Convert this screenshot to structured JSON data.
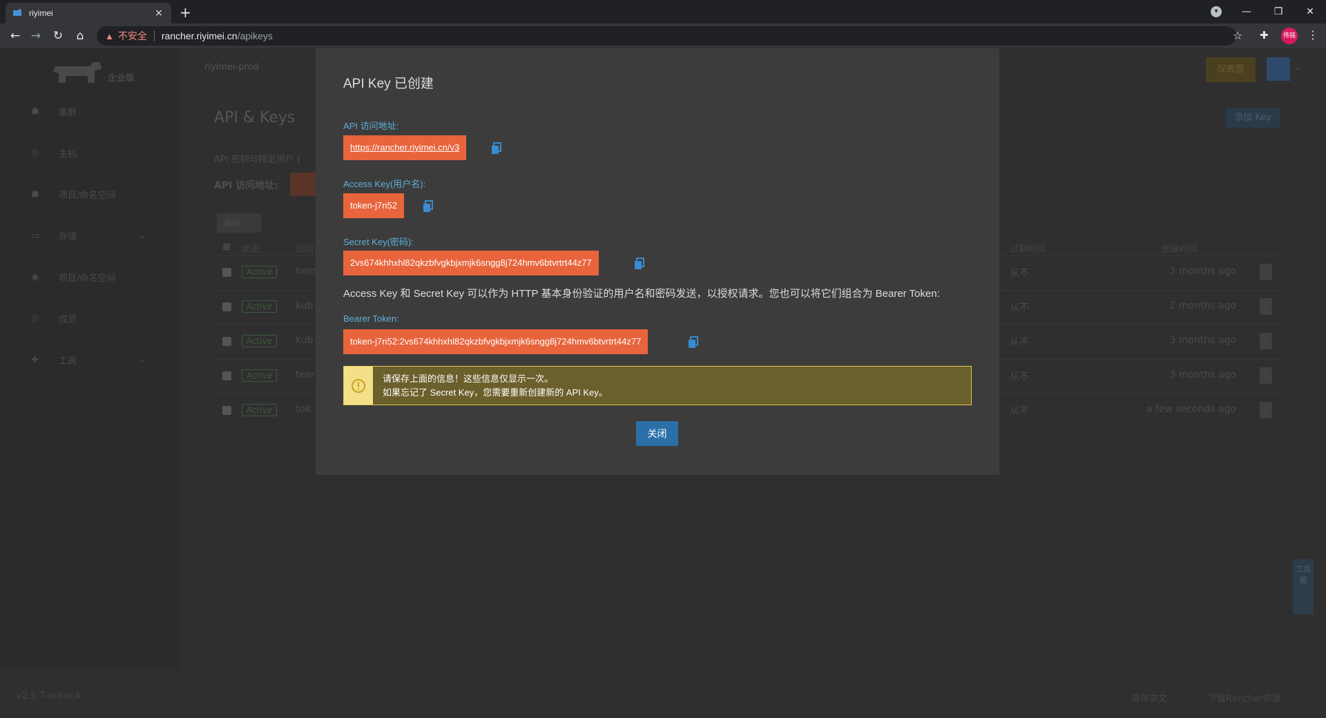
{
  "browser": {
    "tab_title": "riyimei",
    "tab_close": "×",
    "new_tab": "+",
    "insecure_label": "不安全",
    "url_host": "rancher.riyimei.cn",
    "url_path": "/apikeys",
    "profile_initials": "伟铭"
  },
  "app": {
    "logo_sub": "企业版",
    "cluster_selector": "riyimei-prod",
    "page_title": "API & Keys",
    "add_key_button": "添加 Key",
    "description": "API 密钥与特定用户 (",
    "api_endpoint_label": "API 访问地址:",
    "api_endpoint_partial": "http",
    "delete_button": "删除",
    "upgrade_button": "仪表盘",
    "sidebar": [
      {
        "label": "集群",
        "icon": "cluster-icon"
      },
      {
        "label": "主机",
        "icon": "host-icon"
      },
      {
        "label": "项目/命名空间",
        "icon": "project-icon"
      },
      {
        "label": "存储",
        "icon": "storage-icon",
        "caret": true
      },
      {
        "label": "项目/命名空间",
        "icon": "namespace-icon"
      },
      {
        "label": "成员",
        "icon": "member-icon"
      },
      {
        "label": "工具",
        "icon": "tools-icon",
        "caret": true
      }
    ],
    "table": {
      "headers": {
        "state": "状态",
        "name": "访问",
        "expires": "过期时间",
        "created": "创建时间"
      },
      "rows": [
        {
          "state": "Active",
          "name": "helm",
          "expires": "从不",
          "created": "3 months ago"
        },
        {
          "state": "Active",
          "name": "kub",
          "expires": "从不",
          "created": "2 months ago"
        },
        {
          "state": "Active",
          "name": "kub",
          "expires": "从不",
          "created": "3 months ago"
        },
        {
          "state": "Active",
          "name": "tele",
          "expires": "从不",
          "created": "3 months ago"
        },
        {
          "state": "Active",
          "name": "tok",
          "expires": "从不",
          "created": "a few seconds ago"
        }
      ]
    },
    "version": "v2.5.7-ent-rc4",
    "language": "简体中文",
    "download": "下载Rancher资源",
    "side_tab": "工具箱"
  },
  "modal": {
    "title": "API Key 已创建",
    "api_url_label": "API 访问地址:",
    "api_url_value": "https://rancher.riyimei.cn/v3",
    "access_key_label": "Access Key(用户名):",
    "access_key_value": "token-j7n52",
    "secret_key_label": "Secret Key(密码):",
    "secret_key_value": "2vs674khhxhl82qkzbfvgkbjxmjk6sngg8j724hmv6btvrtrt44z77",
    "hint": "Access Key 和 Secret Key 可以作为 HTTP 基本身份验证的用户名和密码发送，以授权请求。您也可以将它们组合为 Bearer Token:",
    "bearer_label": "Bearer Token:",
    "bearer_value": "token-j7n52:2vs674khhxhl82qkzbfvgkbjxmjk6sngg8j724hmv6btvrtrt44z77",
    "warning_line1": "请保存上面的信息！这些信息仅显示一次。",
    "warning_line2": "如果忘记了 Secret Key，您需要重新创建新的 API Key。",
    "close_button": "关闭"
  },
  "colors": {
    "accent_orange": "#e8643c",
    "label_blue": "#5fb0d8",
    "button_blue": "#2a6fa8",
    "warning_bg": "#6b5f2c",
    "warning_border": "#e0c84a"
  }
}
